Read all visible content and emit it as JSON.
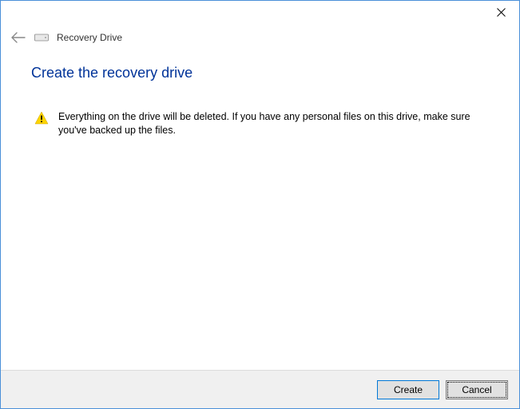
{
  "titlebar": {
    "close_label": "Close"
  },
  "header": {
    "app_title": "Recovery Drive"
  },
  "main": {
    "heading": "Create the recovery drive",
    "warning_text": "Everything on the drive will be deleted. If you have any personal files on this drive, make sure you've backed up the files."
  },
  "footer": {
    "create_label": "Create",
    "cancel_label": "Cancel"
  }
}
